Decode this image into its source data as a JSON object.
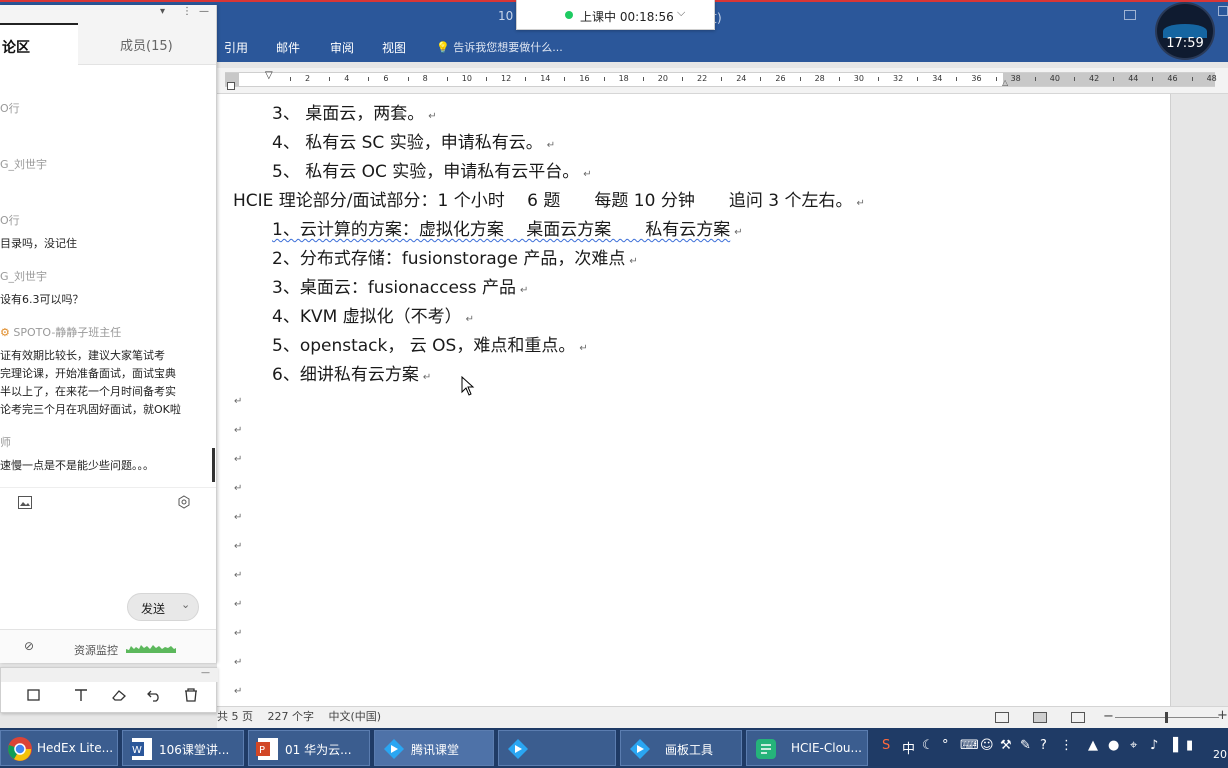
{
  "word": {
    "title_left": "10",
    "title_right": "文)",
    "tabs": [
      "引用",
      "邮件",
      "审阅",
      "视图"
    ],
    "search_placeholder": "告诉我您想要做什么..."
  },
  "recording": {
    "label": "上课中 00:18:56",
    "status_color": "#1ecb62"
  },
  "clock": {
    "time": "17:59"
  },
  "ruler": {
    "numbers": [
      "2",
      "4",
      "6",
      "8",
      "10",
      "12",
      "14",
      "16",
      "18",
      "20",
      "22",
      "24",
      "26",
      "28",
      "30",
      "32",
      "34",
      "36",
      "38",
      "40",
      "42",
      "44",
      "46",
      "48"
    ]
  },
  "document": {
    "lines": [
      {
        "id": "l1",
        "text": "3、 桌面云，两套。"
      },
      {
        "id": "l2",
        "text": "4、 私有云 SC 实验，申请私有云。"
      },
      {
        "id": "l3",
        "text": "5、 私有云 OC 实验，申请私有云平台。"
      },
      {
        "id": "l4",
        "text": "HCIE 理论部分/面试部分：1 个小时　 6 题　　每题 10 分钟　　追问 3 个左右。"
      },
      {
        "id": "l5",
        "text": "1、云计算的方案：虚拟化方案　 桌面云方案　　私有云方案"
      },
      {
        "id": "l6",
        "text": "2、分布式存储：fusionstorage 产品，次难点"
      },
      {
        "id": "l7",
        "text": "3、桌面云：fusionaccess 产品"
      },
      {
        "id": "l8",
        "text": "4、KVM 虚拟化（不考）"
      },
      {
        "id": "l9",
        "text": "5、openstack， 云 OS，难点和重点。"
      },
      {
        "id": "l10",
        "text": "6、细讲私有云方案"
      }
    ],
    "paragraph_mark": "↵"
  },
  "chat": {
    "tab_discuss": "论区",
    "tab_members": "成员(15)",
    "messages": [
      {
        "name": "O行",
        "text": ""
      },
      {
        "name": "G_刘世宇",
        "text": ""
      },
      {
        "name": "O行",
        "text": "目录吗，没记住"
      },
      {
        "name": "G_刘世宇",
        "text": "设有6.3可以吗？"
      },
      {
        "name": "SPOTO-静静子班主任",
        "lines": [
          "证有效期比较长，建议大家笔试考",
          "完理论课，开始准备面试，面试宝典",
          "半以上了，在来花一个月时间备考实",
          "论考完三个月在巩固好面试，就OK啦"
        ]
      },
      {
        "name": "师",
        "text": "速慢一点是不是能少些问题。。。"
      }
    ],
    "send_label": "发送",
    "resource_monitor": "资源监控"
  },
  "statusbar": {
    "text": "共 5 页　 227 个字　 中文(中国)"
  },
  "taskbar": {
    "items": [
      {
        "label": "HedEx Lite...",
        "icon": "chrome-icon"
      },
      {
        "label": "106课堂讲...",
        "icon": "word-icon"
      },
      {
        "label": "01 华为云...",
        "icon": "powerpoint-icon"
      },
      {
        "label": "腾讯课堂",
        "icon": "tencent-class-icon"
      },
      {
        "label": "",
        "icon": "tencent-class-icon"
      },
      {
        "label": "画板工具",
        "icon": "tencent-class-icon"
      },
      {
        "label": "HCIE-Clou...",
        "icon": "doc-icon"
      }
    ],
    "tray_lang": "中",
    "year_fragment": "20"
  }
}
